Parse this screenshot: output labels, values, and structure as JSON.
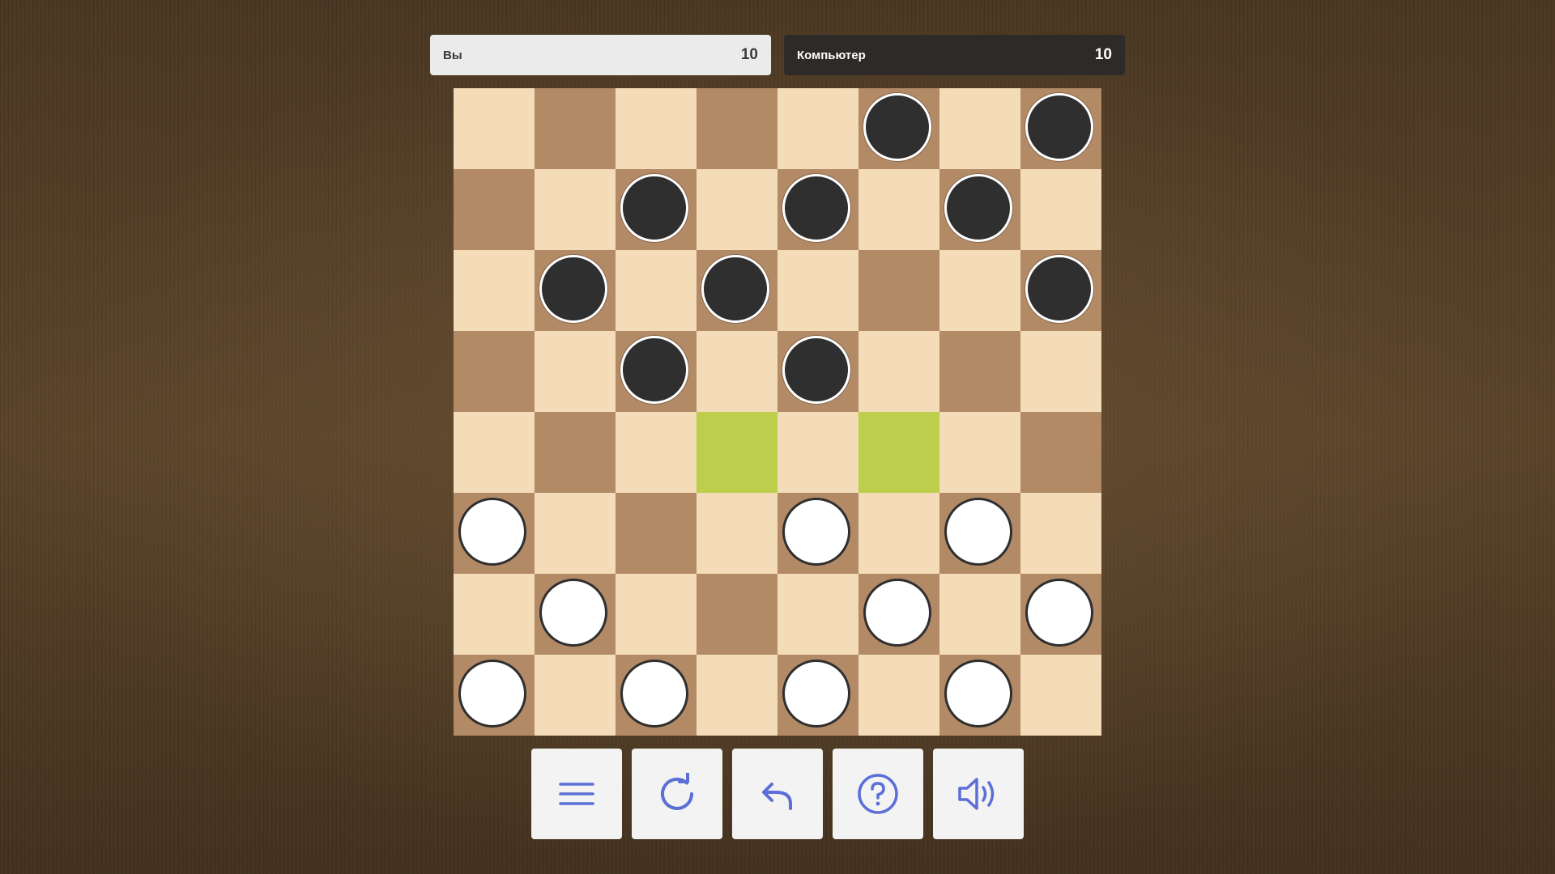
{
  "scoreboard": {
    "player": {
      "name": "Вы",
      "score": "10"
    },
    "computer": {
      "name": "Компьютер",
      "score": "10"
    }
  },
  "board": {
    "size": 8,
    "rows": [
      [
        "",
        "",
        "",
        "",
        "",
        "b",
        "",
        "b"
      ],
      [
        "",
        "",
        "b",
        "",
        "b",
        "",
        "b",
        ""
      ],
      [
        "",
        "b",
        "",
        "b",
        "",
        "",
        "",
        "b"
      ],
      [
        "",
        "",
        "b",
        "",
        "b",
        "",
        "",
        ""
      ],
      [
        "",
        "",
        "",
        "h",
        "",
        "h",
        "",
        ""
      ],
      [
        "w",
        "",
        "",
        "",
        "w",
        "",
        "w",
        ""
      ],
      [
        "",
        "w",
        "",
        "",
        "",
        "w",
        "",
        "w"
      ],
      [
        "w",
        "",
        "w",
        "",
        "w",
        "",
        "w",
        ""
      ]
    ],
    "legend": {
      "b": "black-piece",
      "w": "white-piece",
      "h": "highlighted-square"
    }
  },
  "colors": {
    "light_square": "#f4dcb8",
    "dark_square": "#b38a66",
    "highlight_square": "#bcce4c",
    "black_piece": "#2f2f2f",
    "white_piece": "#ffffff",
    "icon_accent": "#5b6fd6"
  },
  "controls": [
    {
      "name": "menu-button",
      "icon": "menu-icon"
    },
    {
      "name": "restart-button",
      "icon": "refresh-icon"
    },
    {
      "name": "undo-button",
      "icon": "undo-icon"
    },
    {
      "name": "help-button",
      "icon": "help-icon"
    },
    {
      "name": "sound-button",
      "icon": "speaker-icon"
    }
  ]
}
